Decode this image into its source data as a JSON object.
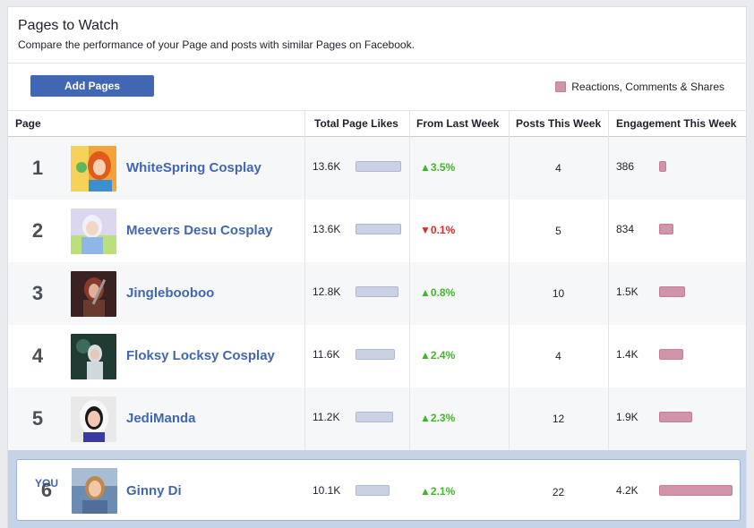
{
  "header": {
    "title": "Pages to Watch",
    "subtitle": "Compare the performance of your Page and posts with similar Pages on Facebook."
  },
  "toolbar": {
    "add_pages_label": "Add Pages",
    "legend_label": "Reactions, Comments & Shares"
  },
  "columns": {
    "page": "Page",
    "total_likes": "Total Page Likes",
    "from_last_week": "From Last Week",
    "posts_this_week": "Posts This Week",
    "engagement_this_week": "Engagement This Week"
  },
  "colors": {
    "link": "#4267b2",
    "up": "#42b72a",
    "down": "#e02a2a",
    "likes_bar": "#c9d1e3",
    "engagement_bar": "#d193aa"
  },
  "rows": [
    {
      "rank": "1",
      "name": "WhiteSpring Cosplay",
      "likes": "13.6K",
      "likes_value": 13.6,
      "delta": "3.5%",
      "trend": "up",
      "posts": "4",
      "engagement": "386",
      "engagement_value": 386
    },
    {
      "rank": "2",
      "name": "Meevers Desu Cosplay",
      "likes": "13.6K",
      "likes_value": 13.6,
      "delta": "0.1%",
      "trend": "down",
      "posts": "5",
      "engagement": "834",
      "engagement_value": 834
    },
    {
      "rank": "3",
      "name": "Jinglebooboo",
      "likes": "12.8K",
      "likes_value": 12.8,
      "delta": "0.8%",
      "trend": "up",
      "posts": "10",
      "engagement": "1.5K",
      "engagement_value": 1500
    },
    {
      "rank": "4",
      "name": "Floksy Locksy Cosplay",
      "likes": "11.6K",
      "likes_value": 11.6,
      "delta": "2.4%",
      "trend": "up",
      "posts": "4",
      "engagement": "1.4K",
      "engagement_value": 1400
    },
    {
      "rank": "5",
      "name": "JediManda",
      "likes": "11.2K",
      "likes_value": 11.2,
      "delta": "2.3%",
      "trend": "up",
      "posts": "12",
      "engagement": "1.9K",
      "engagement_value": 1900
    }
  ],
  "you": {
    "label": "YOU",
    "rank": "6",
    "name": "Ginny Di",
    "likes": "10.1K",
    "likes_value": 10.1,
    "delta": "2.1%",
    "trend": "up",
    "posts": "22",
    "engagement": "4.2K",
    "engagement_value": 4200
  }
}
